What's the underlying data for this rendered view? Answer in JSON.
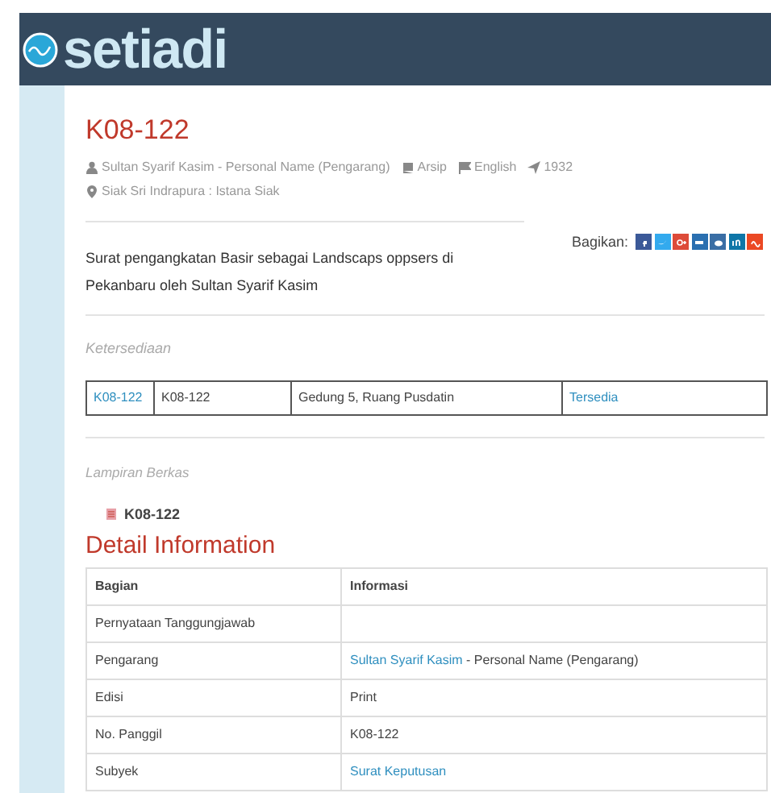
{
  "header": {
    "logo_text": "setiadi"
  },
  "record": {
    "title": "K08-122",
    "author": "Sultan Syarif Kasim - Personal Name (Pengarang)",
    "type": "Arsip",
    "language": "English",
    "year": "1932",
    "place": "Siak Sri Indrapura : Istana Siak"
  },
  "share": {
    "label": "Bagikan:",
    "buttons": [
      {
        "kind": "facebook",
        "color": "#3b5998"
      },
      {
        "kind": "twitter",
        "color": "#33aaee"
      },
      {
        "kind": "googleplus",
        "color": "#dd4b39"
      },
      {
        "kind": "email",
        "color": "#2a6fb0"
      },
      {
        "kind": "reddit",
        "color": "#3a6ea5"
      },
      {
        "kind": "linkedin",
        "color": "#0e76a8"
      },
      {
        "kind": "stumble",
        "color": "#eb4924"
      }
    ]
  },
  "description": "Surat pengangkatan Basir sebagai Landscaps oppsers di Pekanbaru oleh Sultan Syarif Kasim",
  "availability": {
    "heading": "Ketersediaan",
    "row": [
      "K08-122",
      "K08-122",
      "Gedung 5, Ruang Pusdatin",
      "Tersedia"
    ]
  },
  "attachments": {
    "heading": "Lampiran Berkas",
    "files": [
      "K08-122"
    ]
  },
  "detail": {
    "heading": "Detail Information",
    "columns": [
      "Bagian",
      "Informasi"
    ],
    "rows": [
      {
        "label": "Pernyataan Tanggungjawab"
      },
      {
        "label": "Pengarang",
        "link": "Sultan Syarif Kasim",
        "value": " - Personal Name (Pengarang)"
      },
      {
        "label": "Edisi",
        "value": "Print"
      },
      {
        "label": "No. Panggil",
        "value": "K08-122"
      },
      {
        "label": "Subyek",
        "link": "Surat Keputusan"
      }
    ]
  }
}
